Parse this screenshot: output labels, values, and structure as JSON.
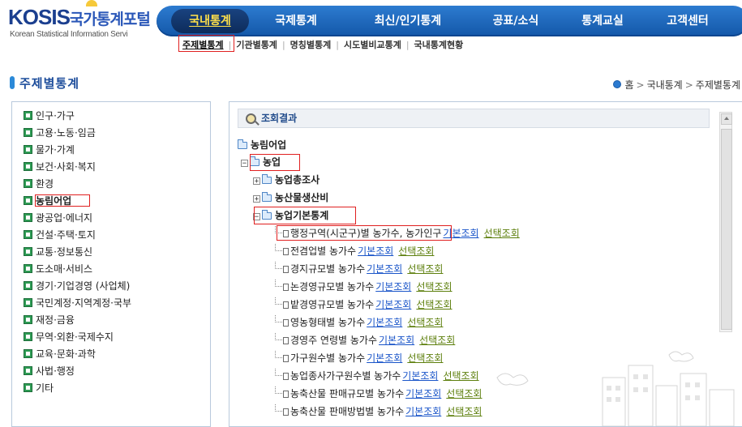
{
  "header": {
    "logo_main": "KOSIS",
    "logo_kr": "국가통계포털",
    "logo_sub": "Korean Statistical Information Servi",
    "gnb": [
      {
        "label": "국내통계"
      },
      {
        "label": "국제통계"
      },
      {
        "label": "최신/인기통계"
      },
      {
        "label": "공표/소식"
      },
      {
        "label": "통계교실"
      },
      {
        "label": "고객센터"
      }
    ],
    "subnav": [
      {
        "label": "주제별통계"
      },
      {
        "label": "기관별통계"
      },
      {
        "label": "명칭별통계"
      },
      {
        "label": "시도별비교통계"
      },
      {
        "label": "국내통계현황"
      }
    ],
    "subnav_sep": "|"
  },
  "page": {
    "title": "주제별통계",
    "breadcrumb": [
      "홈",
      "국내통계",
      "주제별통계"
    ],
    "breadcrumb_sep": ">"
  },
  "sidebar": {
    "items": [
      {
        "label": "인구·가구"
      },
      {
        "label": "고용·노동·임금"
      },
      {
        "label": "물가·가계"
      },
      {
        "label": "보건·사회·복지"
      },
      {
        "label": "환경"
      },
      {
        "label": "농림어업"
      },
      {
        "label": "광공업·에너지"
      },
      {
        "label": "건설·주택·토지"
      },
      {
        "label": "교통·정보통신"
      },
      {
        "label": "도소매·서비스"
      },
      {
        "label": "경기·기업경영 (사업체)"
      },
      {
        "label": "국민계정·지역계정·국부"
      },
      {
        "label": "재정·금융"
      },
      {
        "label": "무역·외환·국제수지"
      },
      {
        "label": "교육·문화·과학"
      },
      {
        "label": "사법·행정"
      },
      {
        "label": "기타"
      }
    ]
  },
  "results": {
    "header": "조회결과",
    "root": "농림어업",
    "level1": "농업",
    "expand_plus": "+",
    "expand_minus": "−",
    "folders": [
      {
        "label": "농업총조사"
      },
      {
        "label": "농산물생산비"
      },
      {
        "label": "농업기본통계"
      }
    ],
    "leaves": [
      {
        "label": "행정구역(시군구)별 농가수, 농가인구"
      },
      {
        "label": "전겸업별 농가수"
      },
      {
        "label": "경지규모별 농가수"
      },
      {
        "label": "논경영규모별 농가수"
      },
      {
        "label": "밭경영규모별 농가수"
      },
      {
        "label": "영농형태별 농가수"
      },
      {
        "label": "경영주 연령별 농가수"
      },
      {
        "label": "가구원수별 농가수"
      },
      {
        "label": "농업종사가구원수별 농가수"
      },
      {
        "label": "농축산물 판매규모별 농가수"
      },
      {
        "label": "농축산물 판매방법별 농가수"
      }
    ],
    "link_basic": "기본조회",
    "link_select": "선택조회"
  },
  "colors": {
    "gnb": "#1a67be",
    "gnb_active_text": "#ffe04a",
    "highlight": "#e02020",
    "link_basic": "#1a55c9",
    "link_select": "#5d7f0c"
  }
}
